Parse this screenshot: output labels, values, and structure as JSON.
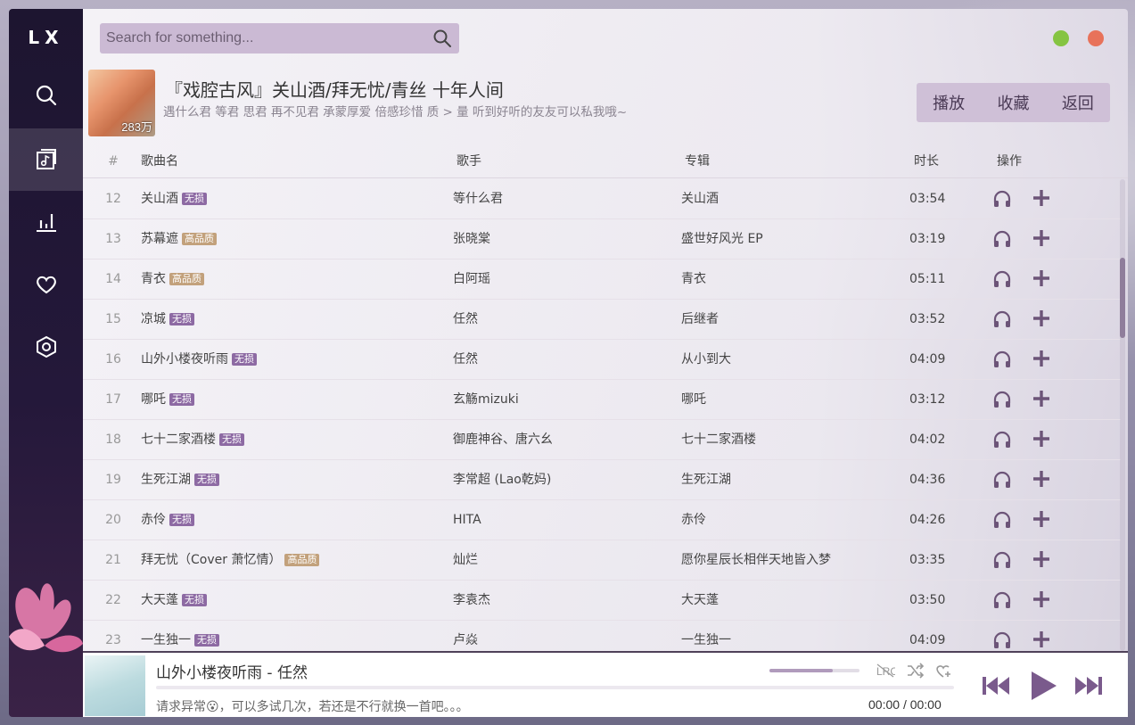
{
  "app": {
    "logo": "LX",
    "colors": {
      "accent": "#8d6aa3",
      "sidebar": "#1d1530",
      "lossless_tag": "#8d6aa3",
      "hq_tag": "#c2a17c"
    }
  },
  "sidebar": {
    "items": [
      {
        "icon": "search-icon",
        "active": false
      },
      {
        "icon": "song-list-icon",
        "active": true
      },
      {
        "icon": "leaderboard-icon",
        "active": false
      },
      {
        "icon": "heart-icon",
        "active": false
      },
      {
        "icon": "settings-icon",
        "active": false
      }
    ]
  },
  "search": {
    "placeholder": "Search for something..."
  },
  "playlist": {
    "title": "『戏腔古风』关山酒/拜无忧/青丝 十年人间",
    "description": "遇什么君 等君 思君 再不见君 承蒙厚爱 倍感珍惜 质 > 量 听到好听的友友可以私我哦~",
    "play_count": "283万",
    "buttons": {
      "play": "播放",
      "collect": "收藏",
      "back": "返回"
    }
  },
  "table": {
    "headers": {
      "num": "#",
      "name": "歌曲名",
      "singer": "歌手",
      "album": "专辑",
      "duration": "时长",
      "actions": "操作"
    },
    "rows": [
      {
        "num": "12",
        "name": "关山酒",
        "tag": "无损",
        "tag_type": "lossless",
        "singer": "等什么君",
        "album": "关山酒",
        "duration": "03:54"
      },
      {
        "num": "13",
        "name": "苏幕遮",
        "tag": "高品质",
        "tag_type": "hq",
        "singer": "张晓棠",
        "album": "盛世好风光 EP",
        "duration": "03:19"
      },
      {
        "num": "14",
        "name": "青衣",
        "tag": "高品质",
        "tag_type": "hq",
        "singer": "白阿瑶",
        "album": "青衣",
        "duration": "05:11"
      },
      {
        "num": "15",
        "name": "凉城",
        "tag": "无损",
        "tag_type": "lossless",
        "singer": "任然",
        "album": "后继者",
        "duration": "03:52"
      },
      {
        "num": "16",
        "name": "山外小楼夜听雨",
        "tag": "无损",
        "tag_type": "lossless",
        "singer": "任然",
        "album": "从小到大",
        "duration": "04:09"
      },
      {
        "num": "17",
        "name": "哪吒",
        "tag": "无损",
        "tag_type": "lossless",
        "singer": "玄觞mizuki",
        "album": "哪吒",
        "duration": "03:12"
      },
      {
        "num": "18",
        "name": "七十二家酒楼",
        "tag": "无损",
        "tag_type": "lossless",
        "singer": "御鹿神谷、唐六幺",
        "album": "七十二家酒楼",
        "duration": "04:02"
      },
      {
        "num": "19",
        "name": "生死江湖",
        "tag": "无损",
        "tag_type": "lossless",
        "singer": "李常超 (Lao乾妈)",
        "album": "生死江湖",
        "duration": "04:36"
      },
      {
        "num": "20",
        "name": "赤伶",
        "tag": "无损",
        "tag_type": "lossless",
        "singer": "HITA",
        "album": "赤伶",
        "duration": "04:26"
      },
      {
        "num": "21",
        "name": "拜无忧（Cover 萧忆情）",
        "tag": "高品质",
        "tag_type": "hq",
        "singer": "灿烂",
        "album": "愿你星辰长相伴天地皆入梦",
        "duration": "03:35"
      },
      {
        "num": "22",
        "name": "大天蓬",
        "tag": "无损",
        "tag_type": "lossless",
        "singer": "李袁杰",
        "album": "大天蓬",
        "duration": "03:50"
      },
      {
        "num": "23",
        "name": "一生独一",
        "tag": "无损",
        "tag_type": "lossless",
        "singer": "卢焱",
        "album": "一生独一",
        "duration": "04:09"
      }
    ]
  },
  "player": {
    "title": "山外小楼夜听雨 - 任然",
    "message": "请求异常😮，可以多试几次，若还是不行就换一首吧。。。",
    "current_time": "00:00",
    "separator": "/",
    "total_time": "00:00",
    "volume": 0.7,
    "progress": 0
  }
}
